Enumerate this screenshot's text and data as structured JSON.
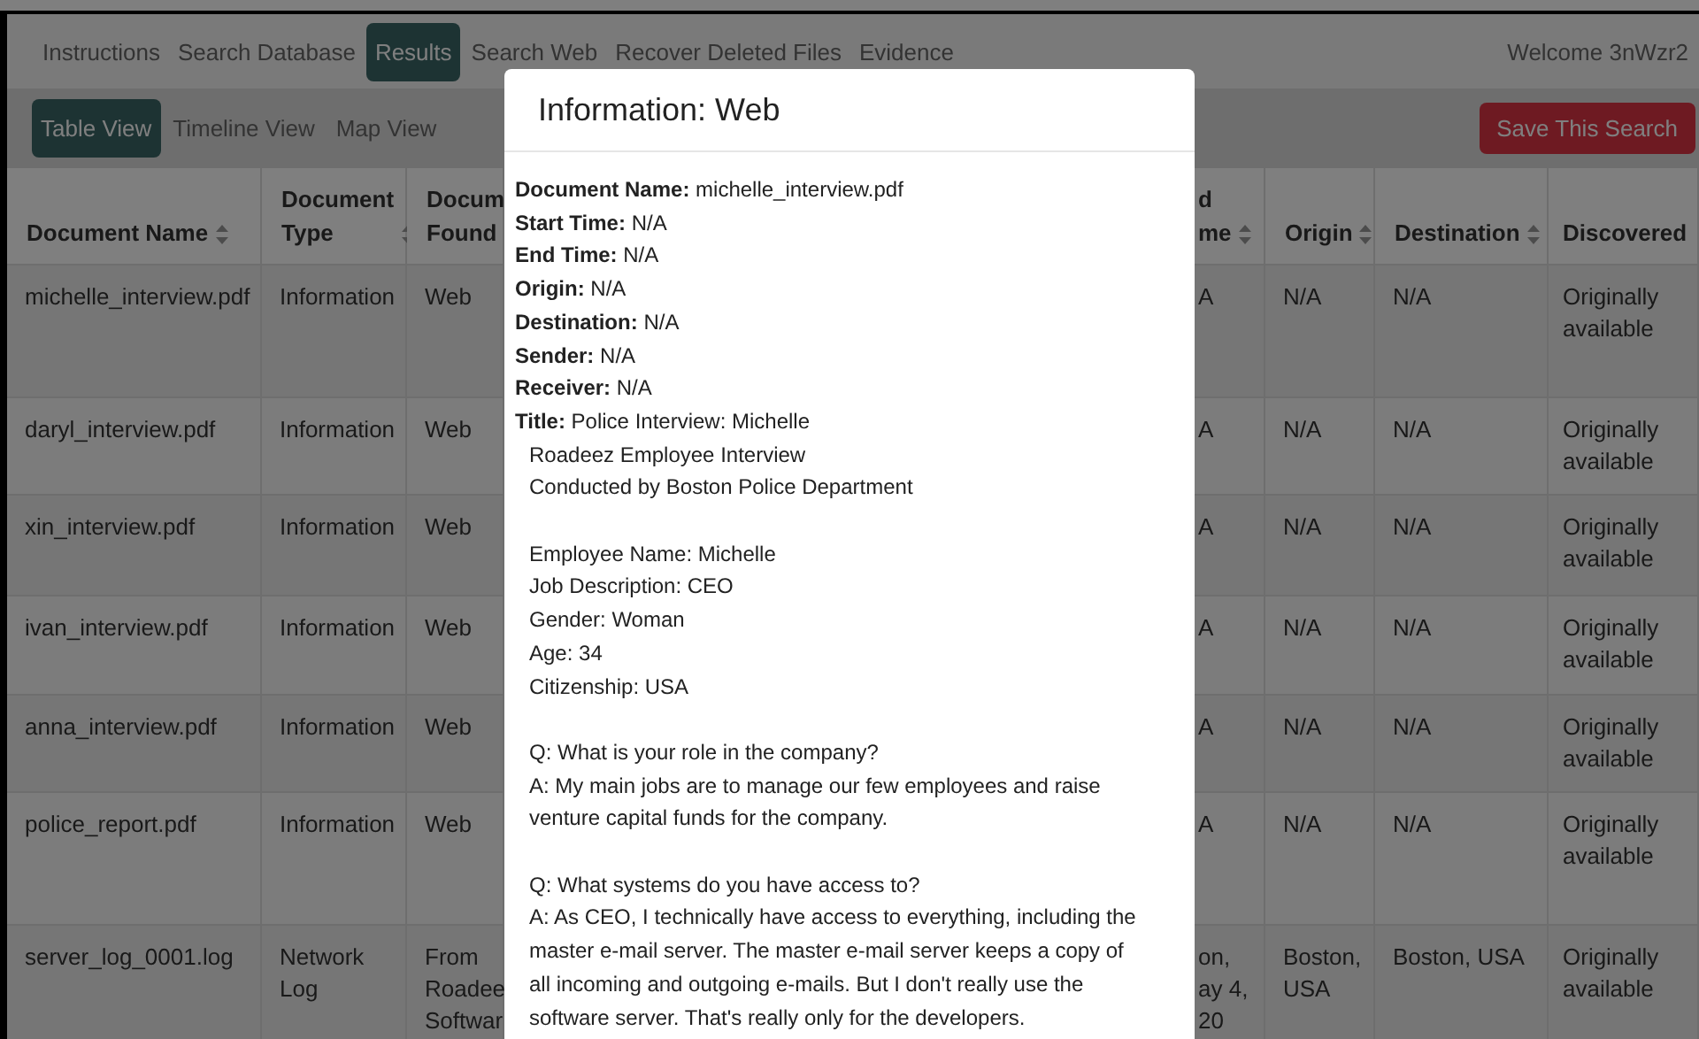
{
  "nav": {
    "items": [
      {
        "label": "Instructions",
        "selected": false
      },
      {
        "label": "Search Database",
        "selected": false
      },
      {
        "label": "Results",
        "selected": true
      },
      {
        "label": "Search Web",
        "selected": false
      },
      {
        "label": "Recover Deleted Files",
        "selected": false
      },
      {
        "label": "Evidence",
        "selected": false
      }
    ],
    "welcome": "Welcome 3nWzr2"
  },
  "views": {
    "items": [
      {
        "label": "Table View",
        "selected": true
      },
      {
        "label": "Timeline View",
        "selected": false
      },
      {
        "label": "Map View",
        "selected": false
      }
    ],
    "save_button": "Save This Search"
  },
  "table": {
    "columns": [
      {
        "label": "Document Name",
        "sortable": true
      },
      {
        "label": "Document Type",
        "sortable": true
      },
      {
        "label": "Docum\nFound"
      },
      {
        "label": "d\nme",
        "sortable": true
      },
      {
        "label": "Origin",
        "sortable": true
      },
      {
        "label": "Destination",
        "sortable": true
      },
      {
        "label": "Discovered",
        "sortable": false
      }
    ],
    "rows": [
      [
        "michelle_interview.pdf",
        "Information",
        "Web",
        "A",
        "N/A",
        "N/A",
        "Originally available"
      ],
      [
        "daryl_interview.pdf",
        "Information",
        "Web",
        "A",
        "N/A",
        "N/A",
        "Originally available"
      ],
      [
        "xin_interview.pdf",
        "Information",
        "Web",
        "A",
        "N/A",
        "N/A",
        "Originally available"
      ],
      [
        "ivan_interview.pdf",
        "Information",
        "Web",
        "A",
        "N/A",
        "N/A",
        "Originally available"
      ],
      [
        "anna_interview.pdf",
        "Information",
        "Web",
        "A",
        "N/A",
        "N/A",
        "Originally available"
      ],
      [
        "police_report.pdf",
        "Information",
        "Web",
        "A",
        "N/A",
        "N/A",
        "Originally available"
      ],
      [
        "server_log_0001.log",
        "Network Log",
        "From\nRoadee\nSoftwar",
        "on,\nay 4,\n20",
        "Boston, USA",
        "Boston, USA",
        "Originally available"
      ]
    ]
  },
  "modal": {
    "title": "Information: Web",
    "fields": [
      {
        "label": "Document Name:",
        "value": "michelle_interview.pdf"
      },
      {
        "label": "Start Time:",
        "value": "N/A"
      },
      {
        "label": "End Time:",
        "value": "N/A"
      },
      {
        "label": "Origin:",
        "value": "N/A"
      },
      {
        "label": "Destination:",
        "value": "N/A"
      },
      {
        "label": "Sender:",
        "value": "N/A"
      },
      {
        "label": "Receiver:",
        "value": "N/A"
      },
      {
        "label": "Title:",
        "value": "Police Interview: Michelle"
      }
    ],
    "content": [
      [
        "Roadeez Employee Interview",
        "Conducted by Boston Police Department"
      ],
      [
        "Employee Name: Michelle",
        "Job Description: CEO",
        "Gender: Woman",
        "Age: 34",
        "Citizenship: USA"
      ],
      [
        "Q: What is your role in the company?",
        "A: My main jobs are to manage our few employees and raise venture capital funds for the company."
      ],
      [
        "Q: What systems do you have access to?",
        "A: As CEO, I technically have access to everything, including the master e-mail server. The master e-mail server keeps a copy of all incoming and outgoing e-mails. But I don't really use the software server. That's really only for the developers."
      ]
    ]
  }
}
